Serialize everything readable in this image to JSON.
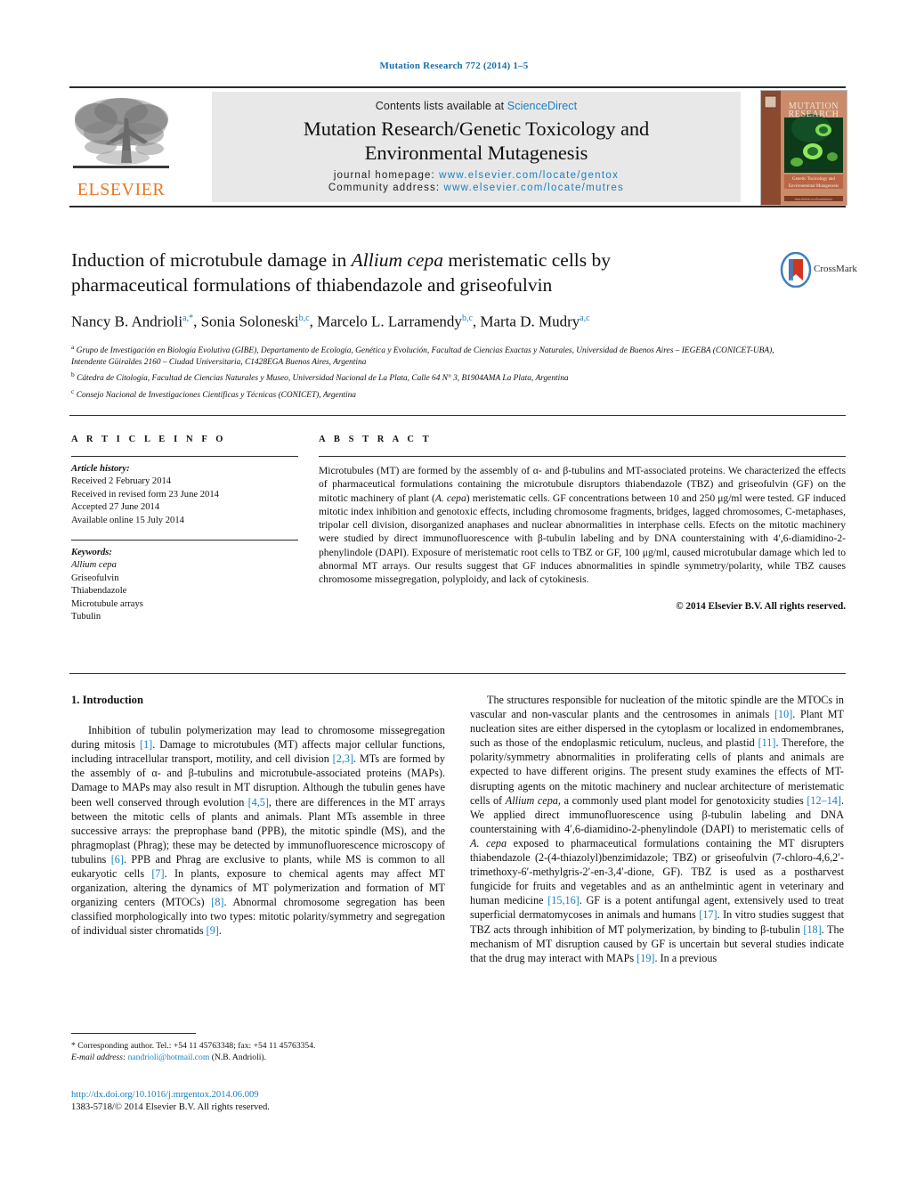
{
  "running_head": "Mutation Research 772 (2014) 1–5",
  "journal_header": {
    "contents_prefix": "Contents lists available at ",
    "contents_link": "ScienceDirect",
    "journal_title_line1": "Mutation Research/Genetic Toxicology and",
    "journal_title_line2": "Environmental Mutagenesis",
    "homepage_label": "journal homepage:",
    "homepage_url": "www.elsevier.com/locate/gentox",
    "community_label": "Community address:",
    "community_url": "www.elsevier.com/locate/mutres",
    "publisher": "ELSEVIER",
    "cover_title_line1": "MUTATION",
    "cover_title_line2": "RESEARCH",
    "cover_sub_line1": "Genetic Toxicology and",
    "cover_sub_line2": "Environmental Mutagenesis"
  },
  "article": {
    "title_part1": "Induction of microtubule damage in ",
    "title_italic": "Allium cepa",
    "title_part2": " meristematic cells by",
    "title_line2": "pharmaceutical formulations of thiabendazole and griseofulvin",
    "crossmark_label": "CrossMark",
    "authors": [
      {
        "name": "Nancy B. Andrioli",
        "marks": "a,*"
      },
      {
        "name": "Sonia Soloneski",
        "marks": "b,c"
      },
      {
        "name": "Marcelo L. Larramendy",
        "marks": "b,c"
      },
      {
        "name": "Marta D. Mudry",
        "marks": "a,c"
      }
    ],
    "affiliations": [
      {
        "mark": "a",
        "text": "Grupo de Investigación en Biología Evolutiva (GIBE), Departamento de Ecología, Genética y Evolución, Facultad de Ciencias Exactas y Naturales, Universidad de Buenos Aires – IEGEBA (CONICET-UBA), Intendente Güiraldes 2160 – Ciudad Universitaria, C1428EGA Buenos Aires, Argentina"
      },
      {
        "mark": "b",
        "text": "Cátedra de Citología, Facultad de Ciencias Naturales y Museo, Universidad Nacional de La Plata, Calle 64 N° 3, B1904AMA La Plata, Argentina"
      },
      {
        "mark": "c",
        "text": "Consejo Nacional de Investigaciones Científicas y Técnicas (CONICET), Argentina"
      }
    ]
  },
  "article_info": {
    "heading": "A R T I C L E   I N F O",
    "history_label": "Article history:",
    "history": [
      "Received 2 February 2014",
      "Received in revised form 23 June 2014",
      "Accepted 27 June 2014",
      "Available online 15 July 2014"
    ],
    "keywords_label": "Keywords:",
    "keywords": [
      "Allium cepa",
      "Griseofulvin",
      "Thiabendazole",
      "Microtubule arrays",
      "Tubulin"
    ]
  },
  "abstract": {
    "heading": "A B S T R A C T",
    "paragraph_1": "Microtubules (MT) are formed by the assembly of α- and β-tubulins and MT-associated proteins. We characterized the effects of pharmaceutical formulations containing the microtubule disruptors thiabendazole (TBZ) and griseofulvin (GF) on the mitotic machinery of plant (",
    "paragraph_1_italic": "A. cepa",
    "paragraph_2": ") meristematic cells. GF concentrations between 10 and 250 μg/ml were tested. GF induced mitotic index inhibition and genotoxic effects, including chromosome fragments, bridges, lagged chromosomes, C-metaphases, tripolar cell division, disorganized anaphases and nuclear abnormalities in interphase cells. Efects on the mitotic machinery were studied by direct immunofluorescence with β-tubulin labeling and by DNA counterstaining with 4′,6-diamidino-2-phenylindole (DAPI). Exposure of meristematic root cells to TBZ or GF, 100 μg/ml, caused microtubular damage which led to abnormal MT arrays. Our results suggest that GF induces abnormalities in spindle symmetry/polarity, while TBZ causes chromosome missegregation, polyploidy, and lack of cytokinesis.",
    "copyright": "© 2014 Elsevier B.V. All rights reserved."
  },
  "body": {
    "section_heading": "1. Introduction",
    "left_p1_a": "Inhibition of tubulin polymerization may lead to chromosome missegregation during mitosis ",
    "left_ref1": "[1]",
    "left_p1_b": ". Damage to microtubules (MT) affects major cellular functions, including intracellular transport, motility, and cell division ",
    "left_ref2": "[2,3]",
    "left_p1_c": ". MTs are formed by the assembly of α- and β-tubulins and microtubule-associated proteins (MAPs). Damage to MAPs may also result in MT disruption. Although the tubulin genes have been well conserved through evolution ",
    "left_ref3": "[4,5]",
    "left_p1_d": ", there are differences in the MT arrays between the mitotic cells of plants and animals. Plant MTs assemble in three successive arrays: the preprophase band (PPB), the mitotic spindle (MS), and the phragmoplast (Phrag); these may be detected by immunofluorescence microscopy of tubulins ",
    "left_ref4": "[6]",
    "left_p1_e": ". PPB and Phrag are exclusive to plants, while MS is common to all eukaryotic cells ",
    "left_ref5": "[7]",
    "left_p1_f": ". In plants, exposure to chemical agents may affect MT organization, altering the dynamics of MT polymerization and formation of MT organizing centers (MTOCs) ",
    "left_ref6": "[8]",
    "left_p1_g": ". Abnormal chromosome segregation has been classified morphologically into two types: mitotic polarity/symmetry and segregation of individual sister chromatids ",
    "left_ref7": "[9]",
    "left_p1_h": ".",
    "right_p1_a": "The structures responsible for nucleation of the mitotic spindle are the MTOCs in vascular and non-vascular plants and the centrosomes in animals ",
    "right_ref1": "[10]",
    "right_p1_b": ". Plant MT nucleation sites are either dispersed in the cytoplasm or localized in endomembranes, such as those of the endoplasmic reticulum, nucleus, and plastid ",
    "right_ref2": "[11]",
    "right_p1_c": ". Therefore, the polarity/symmetry abnormalities in proliferating cells of plants and animals are expected to have different origins. The present study examines the effects of MT-disrupting agents on the mitotic machinery and nuclear architecture of meristematic cells of ",
    "right_italic1": "Allium cepa",
    "right_p1_d": ", a commonly used plant model for genotoxicity studies ",
    "right_ref3": "[12–14]",
    "right_p1_e": ". We applied direct immunofluorescence using β-tubulin labeling and DNA counterstaining with 4′,6-diamidino-2-phenylindole (DAPI) to meristematic cells of ",
    "right_italic2": "A. cepa",
    "right_p1_f": " exposed to pharmaceutical formulations containing the MT disrupters thiabendazole (2-(4-thiazolyl)benzimidazole; TBZ) or griseofulvin (7-chloro-4,6,2′-trimethoxy-6′-methylgris-2′-en-3,4′-dione, GF). TBZ is used as a postharvest fungicide for fruits and vegetables and as an anthelmintic agent in veterinary and human medicine ",
    "right_ref4": "[15,16]",
    "right_p1_g": ". GF is a potent antifungal agent, extensively used to treat superficial dermatomycoses in animals and humans ",
    "right_ref5": "[17]",
    "right_p1_h": ". In vitro studies suggest that TBZ acts through inhibition of MT polymerization, by binding to β-tubulin ",
    "right_ref6": "[18]",
    "right_p1_i": ". The mechanism of MT disruption caused by GF is uncertain but several studies indicate that the drug may interact with MAPs ",
    "right_ref7": "[19]",
    "right_p1_j": ". In a previous"
  },
  "footnote": {
    "star": "*",
    "corresponding": "Corresponding author. Tel.: +54 11 45763348; fax: +54 11 45763354.",
    "email_label": "E-mail address:",
    "email": "nandrioli@hotmail.com",
    "email_suffix": "(N.B. Andrioli)."
  },
  "footer": {
    "doi": "http://dx.doi.org/10.1016/j.mrgentox.2014.06.009",
    "issn_copyright": "1383-5718/© 2014 Elsevier B.V. All rights reserved."
  },
  "colors": {
    "link": "#1a7fc1",
    "elsevier_orange": "#e87722",
    "rule": "#2b2b2b",
    "contents_bg": "#e8e8e8"
  }
}
